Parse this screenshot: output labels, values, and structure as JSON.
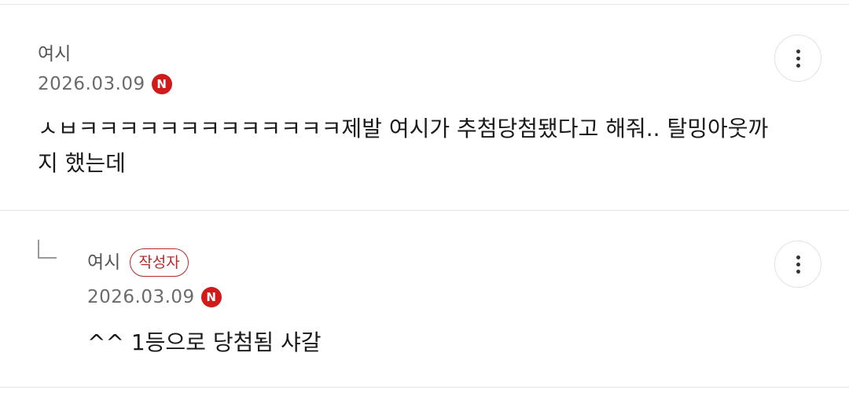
{
  "comments": [
    {
      "author": "여시",
      "date": "2026.03.09",
      "new_badge": "N",
      "body": "ㅅㅂㅋㅋㅋㅋㅋㅋㅋㅋㅋㅋㅋㅋㅋ제발 여시가 추첨당첨됐다고 해줘.. 탈밍아웃까지 했는데",
      "more_icon": "more-vertical-icon"
    }
  ],
  "replies": [
    {
      "author": "여시",
      "writer_badge": "작성자",
      "date": "2026.03.09",
      "new_badge": "N",
      "body": "^^ 1등으로 당첨됨 샤갈",
      "reply_icon": "reply-arrow-icon",
      "more_icon": "more-vertical-icon"
    }
  ],
  "colors": {
    "new_badge": "#d11a1a",
    "writer_badge": "#b82a2a",
    "divider": "#e6e6e6"
  }
}
